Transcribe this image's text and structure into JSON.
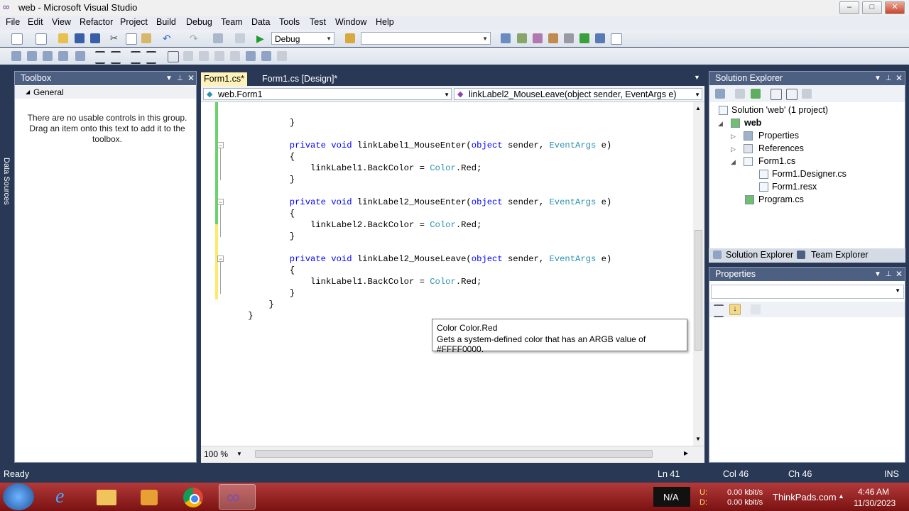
{
  "window": {
    "title": "web - Microsoft Visual Studio"
  },
  "menu": [
    "File",
    "Edit",
    "View",
    "Refactor",
    "Project",
    "Build",
    "Debug",
    "Team",
    "Data",
    "Tools",
    "Test",
    "Window",
    "Help"
  ],
  "toolbar": {
    "config": "Debug",
    "platform": ""
  },
  "left_strip": {
    "label": "Data Sources"
  },
  "toolbox": {
    "title": "Toolbox",
    "group": "General",
    "message": "There are no usable controls in this group. Drag an item onto this text to add it to the toolbox."
  },
  "editor": {
    "tabs": [
      {
        "label": "Form1.cs*"
      },
      {
        "label": "Form1.cs [Design]*"
      }
    ],
    "nav_left": "web.Form1",
    "nav_right": "linkLabel2_MouseLeave(object sender, EventArgs e)",
    "zoom": "100 %",
    "tooltip_title": "Color Color.Red",
    "tooltip_desc": "Gets a system-defined color that has an ARGB value of #FFFF0000."
  },
  "code": [
    "            }",
    "",
    "            private void linkLabel1_MouseEnter(object sender, EventArgs e)",
    "            {",
    "                linkLabel1.BackColor = Color.Red;",
    "            }",
    "",
    "            private void linkLabel2_MouseEnter(object sender, EventArgs e)",
    "            {",
    "                linkLabel2.BackColor = Color.Red;",
    "            }",
    "",
    "            private void linkLabel2_MouseLeave(object sender, EventArgs e)",
    "            {",
    "                linkLabel1.BackColor = Color.Red;",
    "            }",
    "        }",
    "    }"
  ],
  "solution_explorer": {
    "title": "Solution Explorer",
    "items": [
      "Solution 'web' (1 project)",
      "web",
      "Properties",
      "References",
      "Form1.cs",
      "Form1.Designer.cs",
      "Form1.resx",
      "Program.cs"
    ],
    "tabs": [
      "Solution Explorer",
      "Team Explorer"
    ]
  },
  "properties": {
    "title": "Properties"
  },
  "status": {
    "text": "Ready",
    "ln": "Ln 41",
    "col": "Col 46",
    "ch": "Ch 46",
    "mode": "INS"
  },
  "taskbar": {
    "na": "N/A",
    "u_label": "U:",
    "d_label": "D:",
    "up": "0.00 kbit/s",
    "down": "0.00 kbit/s",
    "brand": "ThinkPads.com",
    "time": "4:46 AM",
    "date": "11/30/2023"
  }
}
